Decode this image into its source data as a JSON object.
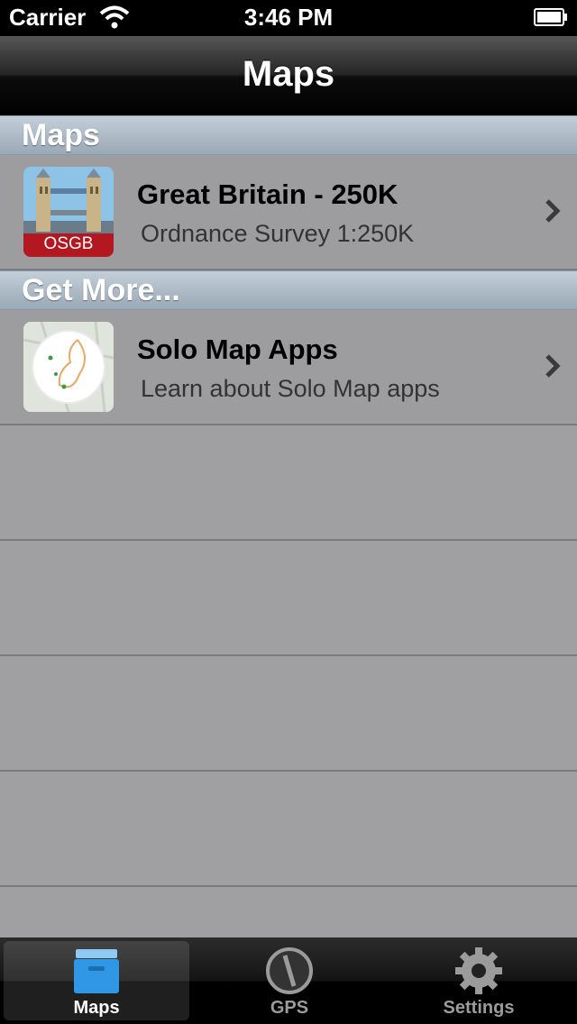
{
  "status_bar": {
    "carrier": "Carrier",
    "time": "3:46 PM"
  },
  "nav": {
    "title": "Maps"
  },
  "sections": [
    {
      "header": "Maps",
      "rows": [
        {
          "title": "Great Britain - 250K",
          "subtitle": "Ordnance Survey 1:250K",
          "badge": "OSGB",
          "icon": "tower-bridge-thumbnail"
        }
      ]
    },
    {
      "header": "Get More...",
      "rows": [
        {
          "title": "Solo Map Apps",
          "subtitle": "Learn about Solo Map apps",
          "icon": "solo-map-thumbnail"
        }
      ]
    }
  ],
  "tabs": [
    {
      "label": "Maps",
      "icon": "maps-box-icon",
      "active": true
    },
    {
      "label": "GPS",
      "icon": "compass-icon",
      "active": false
    },
    {
      "label": "Settings",
      "icon": "gear-icon",
      "active": false
    }
  ],
  "colors": {
    "section_header": "#a8b6c2",
    "row_bg": "#9d9da0",
    "active_tab_icon": "#3aa0e8"
  }
}
